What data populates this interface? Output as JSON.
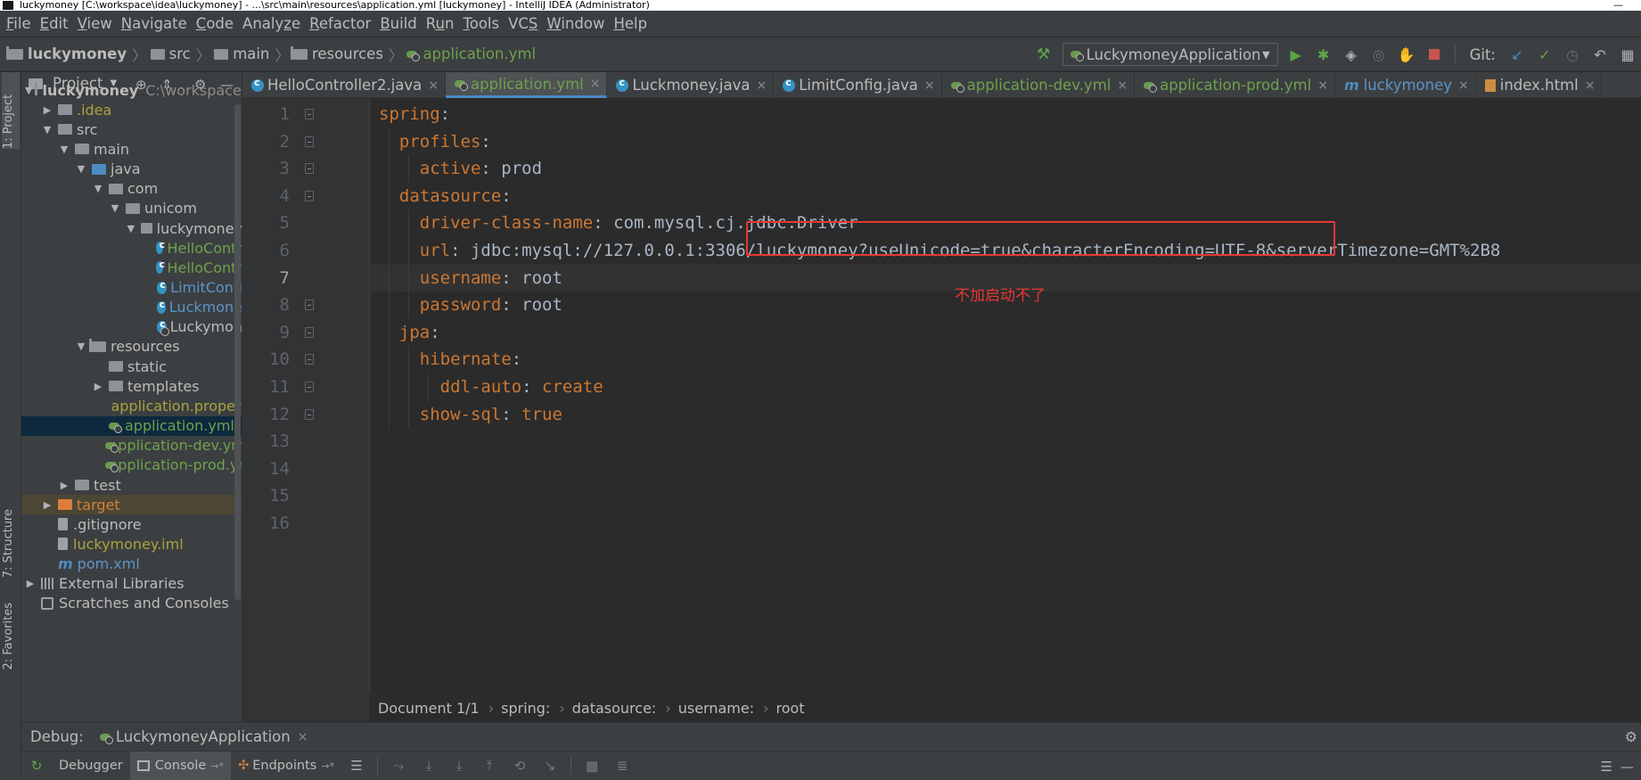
{
  "window": {
    "title": "luckymoney [C:\\workspace\\idea\\luckymoney] - ...\\src\\main\\resources\\application.yml [luckymoney] - IntelliJ IDEA (Administrator)"
  },
  "menu": {
    "items": [
      "File",
      "Edit",
      "View",
      "Navigate",
      "Code",
      "Analyze",
      "Refactor",
      "Build",
      "Run",
      "Tools",
      "VCS",
      "Window",
      "Help"
    ],
    "mnemonics": [
      "F",
      "E",
      "V",
      "N",
      "C",
      "z",
      "R",
      "B",
      "u",
      "T",
      "S",
      "W",
      "H"
    ]
  },
  "navbar": {
    "crumbs": [
      "luckymoney",
      "src",
      "main",
      "resources",
      "application.yml"
    ],
    "run_config": "LuckymoneyApplication",
    "git_label": "Git:"
  },
  "left_strip": {
    "project_tab": "1: Project",
    "structure_tab": "7: Structure",
    "favorites_tab": "2: Favorites"
  },
  "project_panel": {
    "title": "Project",
    "tree": [
      {
        "label": "luckymoney",
        "extra": "C:\\workspace\\idea"
      },
      {
        "label": ".idea"
      },
      {
        "label": "src"
      },
      {
        "label": "main"
      },
      {
        "label": "java"
      },
      {
        "label": "com"
      },
      {
        "label": "unicom"
      },
      {
        "label": "luckymoney"
      },
      {
        "label": "HelloContr"
      },
      {
        "label": "HelloContr"
      },
      {
        "label": "LimitConfi"
      },
      {
        "label": "Luckmone"
      },
      {
        "label": "Luckymon"
      },
      {
        "label": "resources"
      },
      {
        "label": "static"
      },
      {
        "label": "templates"
      },
      {
        "label": "application.properti"
      },
      {
        "label": "application.yml"
      },
      {
        "label": "application-dev.yml"
      },
      {
        "label": "application-prod.ym"
      },
      {
        "label": "test"
      },
      {
        "label": "target"
      },
      {
        "label": ".gitignore"
      },
      {
        "label": "luckymoney.iml"
      },
      {
        "label": "pom.xml"
      },
      {
        "label": "External Libraries"
      },
      {
        "label": "Scratches and Consoles"
      }
    ]
  },
  "tabs": [
    {
      "label": "HelloController2.java"
    },
    {
      "label": "application.yml"
    },
    {
      "label": "Luckmoney.java"
    },
    {
      "label": "LimitConfig.java"
    },
    {
      "label": "application-dev.yml"
    },
    {
      "label": "application-prod.yml"
    },
    {
      "label": "luckymoney"
    },
    {
      "label": "index.html"
    }
  ],
  "editor": {
    "line_numbers": [
      "1",
      "2",
      "3",
      "4",
      "5",
      "6",
      "7",
      "8",
      "9",
      "10",
      "11",
      "12",
      "13",
      "14",
      "15",
      "16"
    ],
    "lines": [
      {
        "indent": "",
        "key": "spring",
        "colon": ":",
        "value": ""
      },
      {
        "indent": "  ",
        "key": "profiles",
        "colon": ":",
        "value": ""
      },
      {
        "indent": "    ",
        "key": "active",
        "colon": ":",
        "value": " prod"
      },
      {
        "indent": "  ",
        "key": "datasource",
        "colon": ":",
        "value": ""
      },
      {
        "indent": "    ",
        "key": "driver-class-name",
        "colon": ":",
        "value": " com.mysql.cj.jdbc.Driver"
      },
      {
        "indent": "    ",
        "key": "url",
        "colon": ":",
        "value": " jdbc:mysql://127.0.0.1:3306/luckymoney?useUnicode=true&characterEncoding=UTF-8&serverTimezone=GMT%2B8"
      },
      {
        "indent": "    ",
        "key": "username",
        "colon": ":",
        "value": " root"
      },
      {
        "indent": "    ",
        "key": "password",
        "colon": ":",
        "value": " root"
      },
      {
        "indent": "  ",
        "key": "jpa",
        "colon": ":",
        "value": ""
      },
      {
        "indent": "    ",
        "key": "hibernate",
        "colon": ":",
        "value": ""
      },
      {
        "indent": "      ",
        "key": "ddl-auto",
        "colon": ":",
        "value": " create"
      },
      {
        "indent": "    ",
        "key": "show-sql",
        "colon": ":",
        "value": " true"
      }
    ],
    "annotation": "不加启动不了"
  },
  "breadcrumbs": {
    "items": [
      "Document 1/1",
      "spring:",
      "datasource:",
      "username:",
      "root"
    ]
  },
  "debug": {
    "label": "Debug:",
    "session": "LuckymoneyApplication"
  },
  "bottom_toolbar": {
    "debugger": "Debugger",
    "console": "Console",
    "endpoints": "Endpoints"
  }
}
